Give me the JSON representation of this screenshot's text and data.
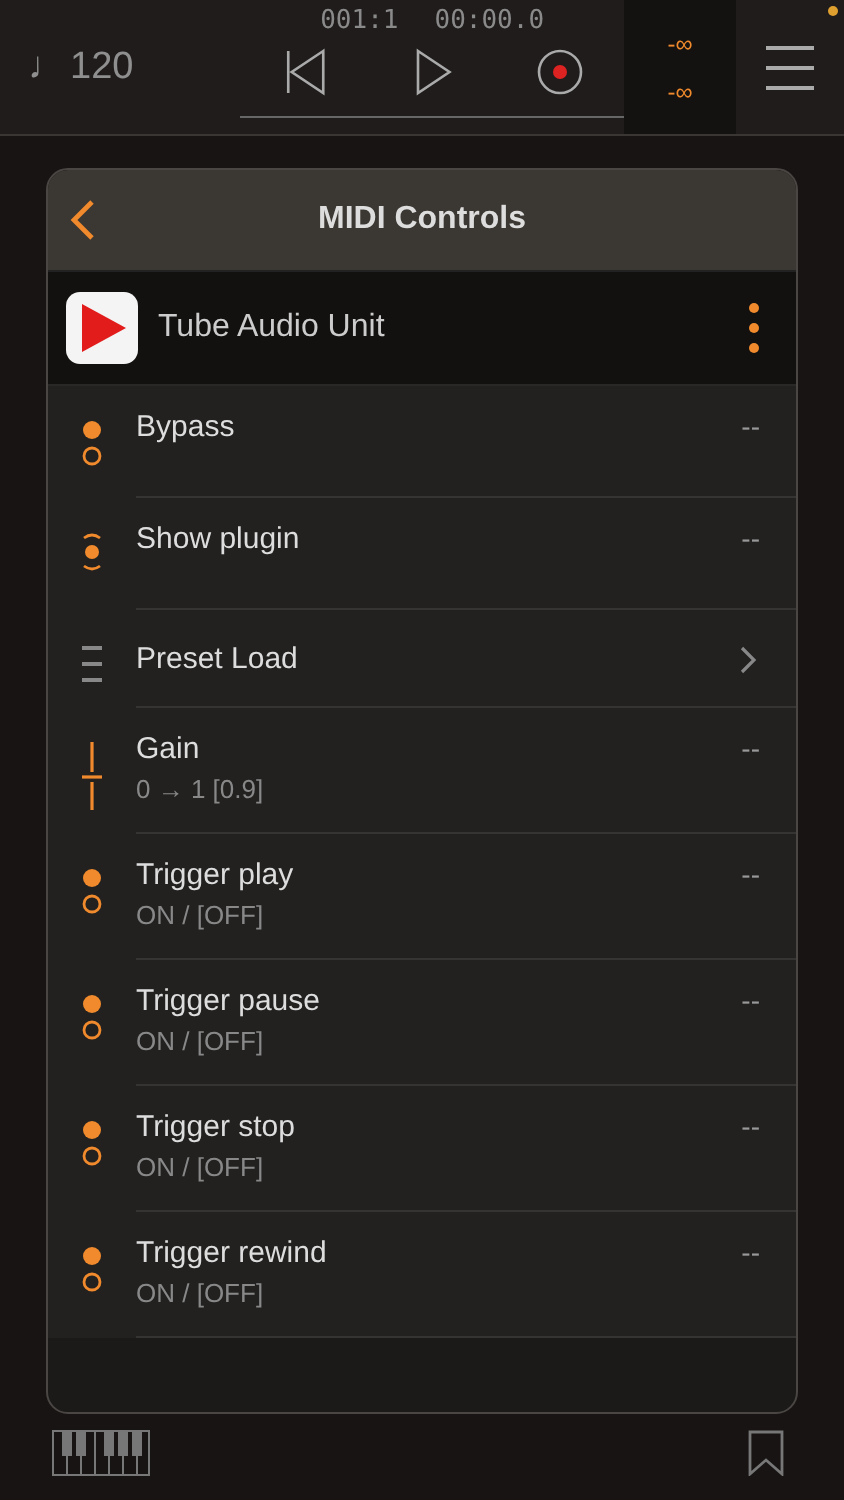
{
  "transport": {
    "tempo_icon": "♩",
    "tempo": "120",
    "position": "001:1",
    "time": "00:00.0",
    "meters": [
      "-∞",
      "-∞"
    ]
  },
  "panel": {
    "title": "MIDI Controls",
    "plugin": {
      "name": "Tube Audio Unit"
    },
    "controls": [
      {
        "kind": "toggle",
        "name": "Bypass",
        "value": "--"
      },
      {
        "kind": "momentary",
        "name": "Show plugin",
        "value": "--"
      },
      {
        "kind": "list",
        "name": "Preset Load"
      },
      {
        "kind": "range",
        "name": "Gain",
        "detail": "0 → 1  [0.9]",
        "value": "--"
      },
      {
        "kind": "toggle",
        "name": "Trigger play",
        "detail": "ON / [OFF]",
        "value": "--"
      },
      {
        "kind": "toggle",
        "name": "Trigger pause",
        "detail": "ON / [OFF]",
        "value": "--"
      },
      {
        "kind": "toggle",
        "name": "Trigger stop",
        "detail": "ON / [OFF]",
        "value": "--"
      },
      {
        "kind": "toggle",
        "name": "Trigger rewind",
        "detail": "ON / [OFF]",
        "value": "--"
      }
    ]
  }
}
